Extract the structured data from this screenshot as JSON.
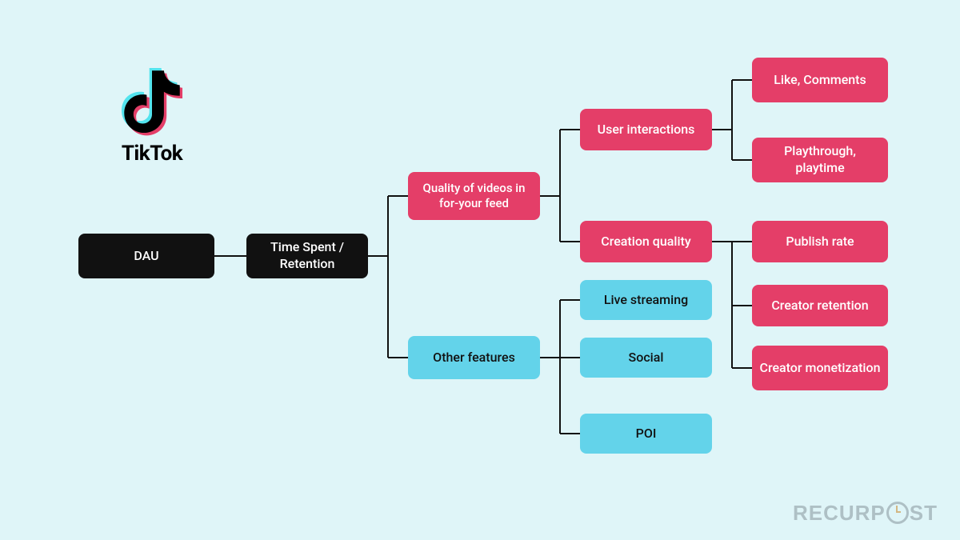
{
  "logo": {
    "name": "TikTok"
  },
  "nodes": {
    "dau": "DAU",
    "timespent": "Time Spent / Retention",
    "quality": "Quality of videos in for-your feed",
    "other": "Other features",
    "userinter": "User interactions",
    "creationq": "Creation quality",
    "live": "Live streaming",
    "social": "Social",
    "poi": "POI",
    "likes": "Like, Comments",
    "playthrough": "Playthrough, playtime",
    "publish": "Publish rate",
    "cretention": "Creator retention",
    "cmonet": "Creator monetization"
  },
  "watermark": {
    "pre": "RECURP",
    "post": "ST"
  }
}
